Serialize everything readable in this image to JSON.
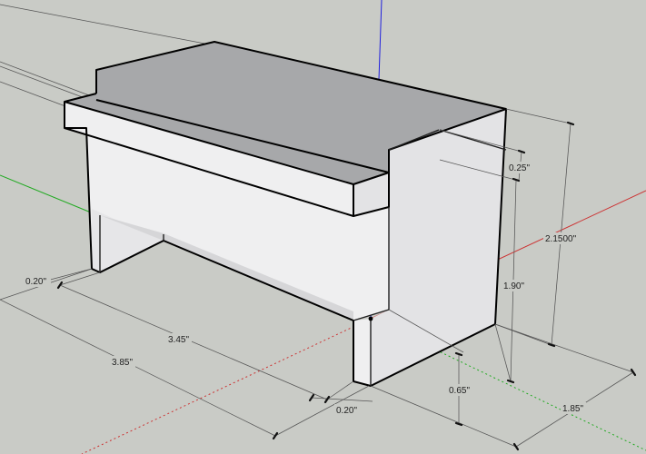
{
  "colors": {
    "background": "#c9cbc6",
    "face_top": "#a7a8aa",
    "face_light": "#efeff0",
    "face_side": "#e3e3e5",
    "face_shadow": "#d6d6d8",
    "edge": "#000000",
    "dimension_line": "#555555",
    "axis_red": "#cc3333",
    "axis_green": "#22aa22",
    "axis_blue": "#2020dd"
  },
  "dimensions": {
    "left_wall_thickness": "0.20\"",
    "inner_length": "3.45\"",
    "overall_length": "3.85\"",
    "right_wall_thickness": "0.20\"",
    "leg_height": "0.65\"",
    "depth": "1.85\"",
    "wall_height": "1.90\"",
    "total_height": "2.1500\"",
    "lid_thickness": "0.25\""
  },
  "icons": {
    "origin": "origin-icon"
  }
}
